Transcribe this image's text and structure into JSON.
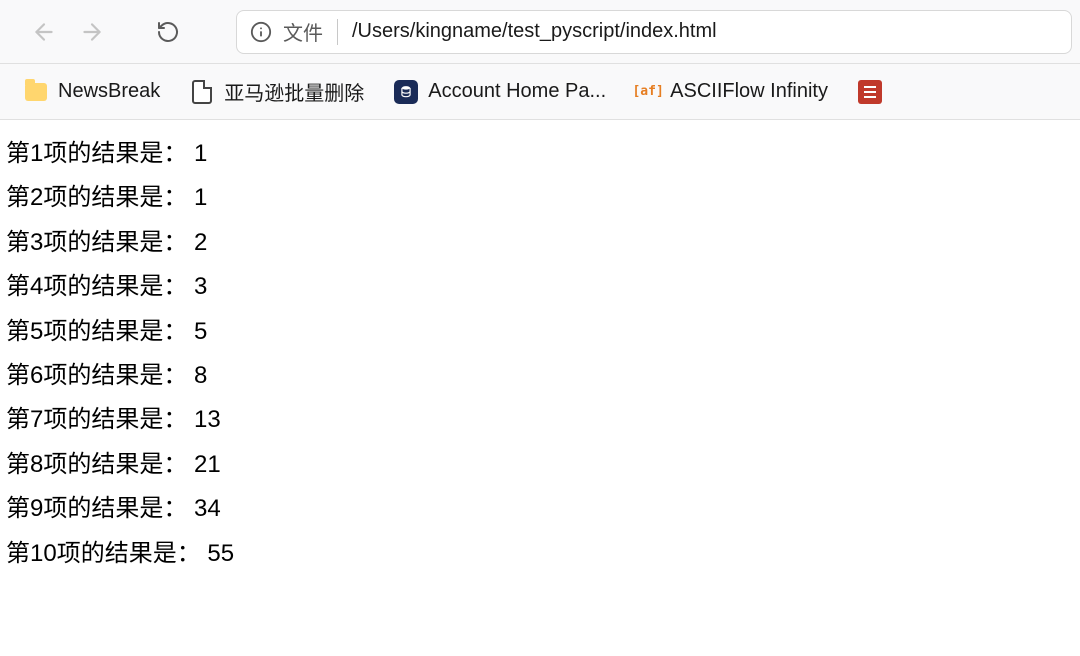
{
  "toolbar": {
    "url_label": "文件",
    "url_path": "/Users/kingname/test_pyscript/index.html"
  },
  "bookmarks": [
    {
      "label": "NewsBreak",
      "icon": "folder"
    },
    {
      "label": "亚马逊批量删除",
      "icon": "file"
    },
    {
      "label": "Account Home Pa...",
      "icon": "db"
    },
    {
      "label": "ASCIIFlow Infinity",
      "icon": "af"
    },
    {
      "label": "",
      "icon": "red"
    }
  ],
  "content": {
    "prefix_template": "第{n}项的结果是：",
    "lines": [
      {
        "index": 1,
        "value": 1
      },
      {
        "index": 2,
        "value": 1
      },
      {
        "index": 3,
        "value": 2
      },
      {
        "index": 4,
        "value": 3
      },
      {
        "index": 5,
        "value": 5
      },
      {
        "index": 6,
        "value": 8
      },
      {
        "index": 7,
        "value": 13
      },
      {
        "index": 8,
        "value": 21
      },
      {
        "index": 9,
        "value": 34
      },
      {
        "index": 10,
        "value": 55
      }
    ]
  }
}
